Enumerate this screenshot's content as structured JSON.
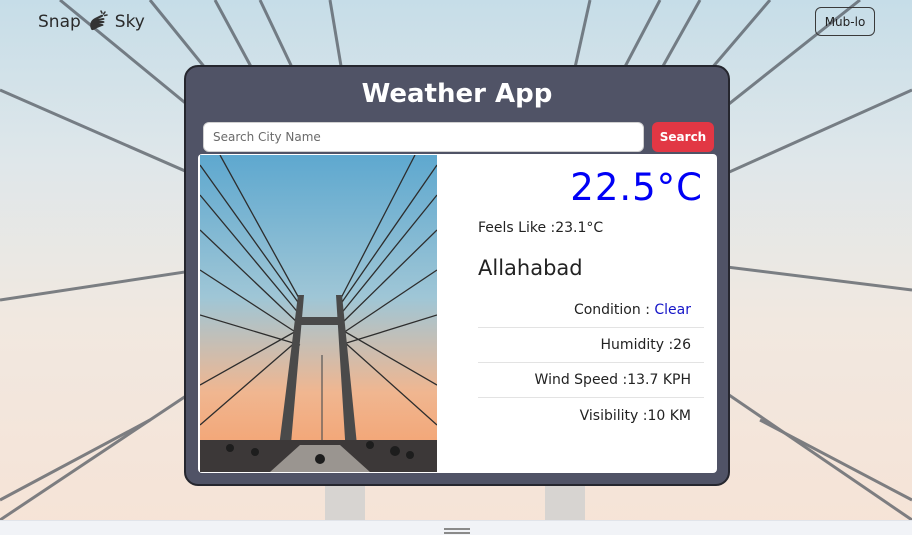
{
  "header": {
    "brand_left": "Snap",
    "brand_right": "Sky",
    "brand_icon": "snap-fingers-icon",
    "nav_button": "Mub-lo"
  },
  "card": {
    "title": "Weather App",
    "search": {
      "placeholder": "Search City Name",
      "value": "",
      "button_label": "Search"
    }
  },
  "weather": {
    "temperature": "22.5°C",
    "feels_like": "Feels Like :23.1°C",
    "city": "Allahabad",
    "condition_label": "Condition : ",
    "condition_value": "Clear",
    "humidity": "Humidity :26",
    "wind_speed": "Wind Speed :13.7 KPH",
    "visibility": "Visibility :10 KM"
  },
  "colors": {
    "accent_red": "#e23744",
    "temperature_blue": "#0000f5",
    "condition_blue": "#1515c8",
    "card_bg": "#505366"
  }
}
